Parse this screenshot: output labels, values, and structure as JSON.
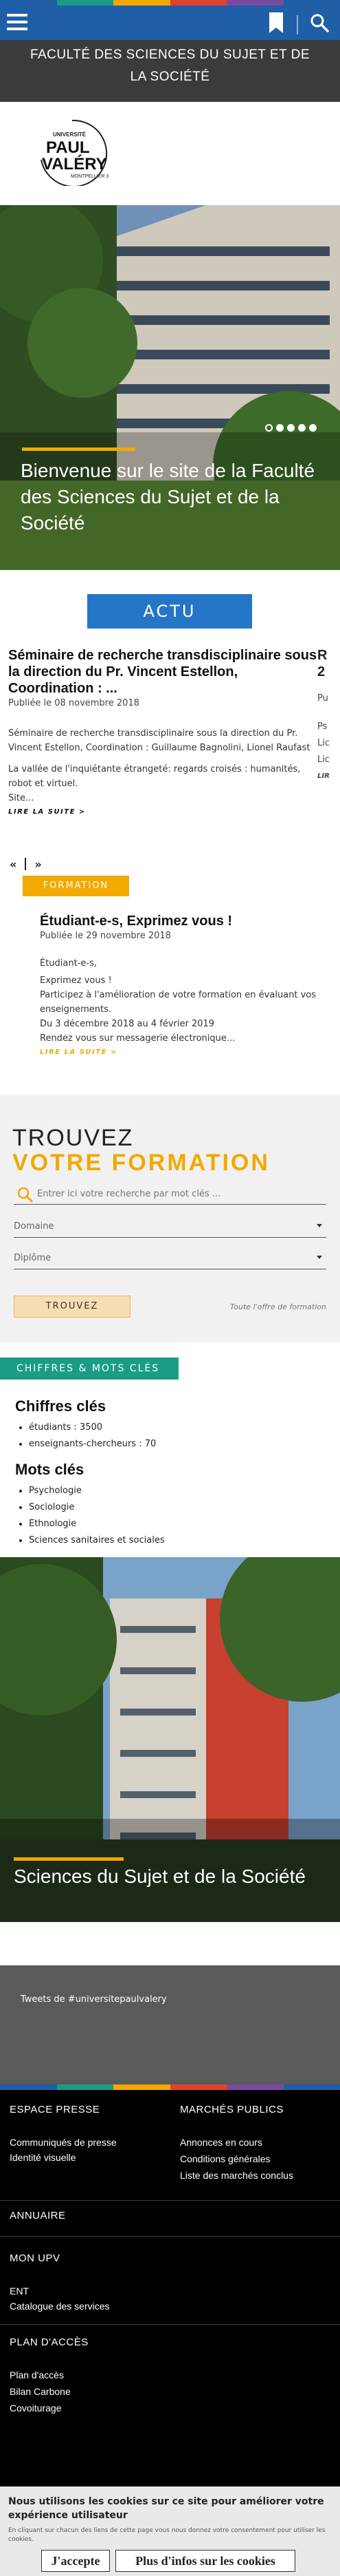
{
  "stripe_colors": [
    "#1f5fa8",
    "#1a9c86",
    "#f2a900",
    "#e0422b",
    "#7a4aa0",
    "#1f5fa8"
  ],
  "header": {
    "site_title": "Faculté des sciences du sujet et de la société",
    "logo_text": {
      "top": "UNIVERSITÉ",
      "main1": "PAUL",
      "main2": "VALÉRY",
      "bottom": "MONTPELLIER 3"
    }
  },
  "hero": {
    "caption": "Bienvenue sur le site de la Faculté des Sciences du Sujet et de la Société",
    "slides": 5,
    "active_slide": 1
  },
  "actu": {
    "label": "ACTU",
    "item1": {
      "title": "Séminaire de recherche transdisciplinaire sous la direction du Pr. Vincent Estellon, Coordination : ...",
      "date": "Publiée le 08 novembre 2018",
      "body1": "Séminaire de recherche transdisciplinaire sous la direction du Pr. Vincent Estellon, Coordination : Guillaume Bagnolini, Lionel Raufast",
      "body2": "La vallée de l'inquiétante étrangeté: regards croisés : humanités, robot et virtuel.",
      "body3": "Site...",
      "more": "LIRE LA SUITE >"
    },
    "peek": {
      "title1": "R",
      "title2": "2",
      "date": "Pu",
      "l1": "Ps",
      "l2": "Lic",
      "l3": "Lic",
      "l4": "LIR"
    },
    "pager_prev": "«",
    "pager_next": "»",
    "formation_tag": "FORMATION",
    "item2": {
      "title": "Étudiant-e-s, Exprimez vous !",
      "date": "Publiée le 29 novembre 2018",
      "l1": "Étudiant-e-s,",
      "l2": "Exprimez vous !",
      "l3": "Participez à l'amélioration de votre formation en évaluant vos enseignements.",
      "l4": "Du 3 décembre 2018 au 4 février 2019",
      "l5": "Rendez vous sur messagerie électronique...",
      "more": "LIRE LA SUITE >"
    }
  },
  "trouvez": {
    "h1": "TROUVEZ",
    "h2": "VOTRE FORMATION",
    "search_placeholder": "Entrer ici votre recherche par mot clés ...",
    "select1": "Domaine",
    "select2": "Diplôme",
    "button": "TROUVEZ",
    "link": "Toute l'offre de formation"
  },
  "chiffres": {
    "tag": "CHIFFRES & MOTS CLÉS",
    "h_chiffres": "Chiffres clés",
    "chiffres_items": [
      "étudiants : 3500",
      "enseignants-chercheurs : 70"
    ],
    "h_mots": "Mots clés",
    "mots_items": [
      "Psychologie",
      "Sociologie",
      "Ethnologie",
      "Sciences sanitaires et sociales"
    ]
  },
  "hero2": {
    "caption": "Sciences du Sujet et de la Société"
  },
  "tweets": {
    "label": "Tweets de #universitepaulvalery"
  },
  "footer": {
    "espace_presse": "ESPACE PRESSE",
    "communiques": "Communiqués de presse",
    "identite": "Identité visuelle",
    "marches": "MARCHÉS PUBLICS",
    "annonces": "Annonces en cours",
    "conditions": "Conditions générales",
    "liste": "Liste des marchés conclus",
    "annuaire": "ANNUAIRE",
    "monupv": "MON UPV",
    "ent": "ENT",
    "catalogue": "Catalogue des services",
    "plan": "PLAN D'ACCÈS",
    "plan_acces": "Plan d'accès",
    "bilan": "Bilan Carbone",
    "covoit": "Covoiturage"
  },
  "cookie": {
    "message": "Nous utilisons les cookies sur ce site pour améliorer votre expérience utilisateur",
    "sub": "En cliquant sur chacun des liens de cette page vous nous donnez votre consentement pour utiliser les cookies.",
    "accept": "J'accepte",
    "more": "Plus d'infos sur les cookies"
  }
}
